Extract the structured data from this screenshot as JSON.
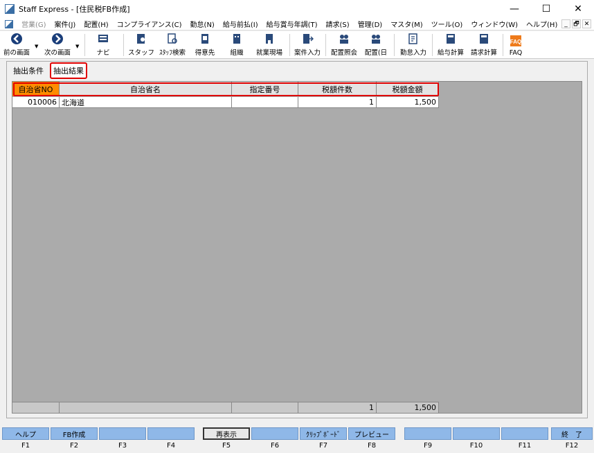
{
  "window": {
    "title": "Staff Express - [住民税FB作成]",
    "minimize": "—",
    "maximize": "☐",
    "close": "✕"
  },
  "menu": [
    {
      "label": "営業(G)",
      "disabled": true
    },
    {
      "label": "案件(J)"
    },
    {
      "label": "配置(H)"
    },
    {
      "label": "コンプライアンス(C)"
    },
    {
      "label": "勤怠(N)"
    },
    {
      "label": "給与前払(I)"
    },
    {
      "label": "給与賞与年調(T)"
    },
    {
      "label": "請求(S)"
    },
    {
      "label": "管理(D)"
    },
    {
      "label": "マスタ(M)"
    },
    {
      "label": "ツール(O)"
    },
    {
      "label": "ウィンドウ(W)"
    },
    {
      "label": "ヘルプ(H)"
    }
  ],
  "mdi_buttons": [
    "_",
    "🗗",
    "✕"
  ],
  "toolbar": {
    "back": "前の画面",
    "forward": "次の画面",
    "navi": "ナビ",
    "staff": "スタッフ",
    "staff_search": "ｽﾀｯﾌ検索",
    "customer": "得意先",
    "organization": "組織",
    "worksite": "就業現場",
    "job_entry": "案件入力",
    "placement_inquiry": "配置照会",
    "placement_day": "配置(日",
    "attendance_entry": "勤怠入力",
    "payroll_calc": "給与計算",
    "billing_calc": "請求計算",
    "faq": "FAQ"
  },
  "tabs": {
    "conditions": "抽出条件",
    "results": "抽出結果"
  },
  "grid": {
    "headers": [
      "自治省NO",
      "自治省名",
      "指定番号",
      "税額件数",
      "税額金額"
    ],
    "rows": [
      [
        "010006",
        "北海道",
        "",
        "1",
        "1,500"
      ]
    ],
    "footer": [
      "",
      "",
      "",
      "1",
      "1,500"
    ]
  },
  "fkeys": [
    {
      "label": "ヘルプ",
      "key": "F1"
    },
    {
      "label": "FB作成",
      "key": "F2"
    },
    {
      "label": "",
      "key": "F3"
    },
    {
      "label": "",
      "key": "F4"
    },
    {
      "label": "再表示",
      "key": "F5"
    },
    {
      "label": "",
      "key": "F6"
    },
    {
      "label": "ｸﾘｯﾌﾟﾎﾞｰﾄﾞ",
      "key": "F7"
    },
    {
      "label": "プレビュー",
      "key": "F8"
    },
    {
      "label": "",
      "key": "F9"
    },
    {
      "label": "",
      "key": "F10"
    },
    {
      "label": "",
      "key": "F11"
    },
    {
      "label": "終　了",
      "key": "F12"
    }
  ],
  "colors": {
    "selected_header": "#ff8c00",
    "highlight_outline": "#e00000",
    "fkey_blue": "#8fb8e8"
  }
}
